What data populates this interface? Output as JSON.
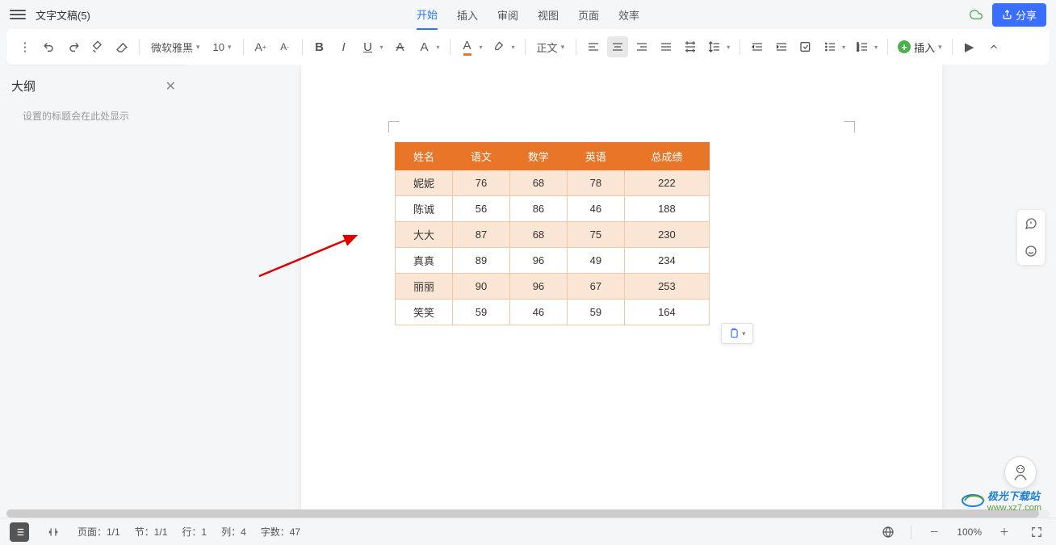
{
  "document": {
    "title": "文字文稿(5)"
  },
  "menu": {
    "tabs": [
      "开始",
      "插入",
      "审阅",
      "视图",
      "页面",
      "效率"
    ],
    "active": 0
  },
  "share": {
    "label": "分享"
  },
  "toolbar": {
    "font_name": "微软雅黑",
    "font_size": "10",
    "style_name": "正文",
    "insert_label": "插入",
    "font_color": "#e97528",
    "highlight_color": "#ffeb3b"
  },
  "sidebar": {
    "title": "大纲",
    "hint": "设置的标题会在此处显示"
  },
  "table": {
    "headers": [
      "姓名",
      "语文",
      "数学",
      "英语",
      "总成绩"
    ],
    "rows": [
      [
        "妮妮",
        "76",
        "68",
        "78",
        "222"
      ],
      [
        "陈诚",
        "56",
        "86",
        "46",
        "188"
      ],
      [
        "大大",
        "87",
        "68",
        "75",
        "230"
      ],
      [
        "真真",
        "89",
        "96",
        "49",
        "234"
      ],
      [
        "丽丽",
        "90",
        "96",
        "67",
        "253"
      ],
      [
        "笑笑",
        "59",
        "46",
        "59",
        "164"
      ]
    ]
  },
  "status": {
    "page": "页面：1/1",
    "section": "节：1/1",
    "line": "行：1",
    "col": "列：4",
    "words": "字数：47",
    "zoom": "100%"
  },
  "watermark": {
    "brand": "极光下载站",
    "url": "www.xz7.com"
  }
}
